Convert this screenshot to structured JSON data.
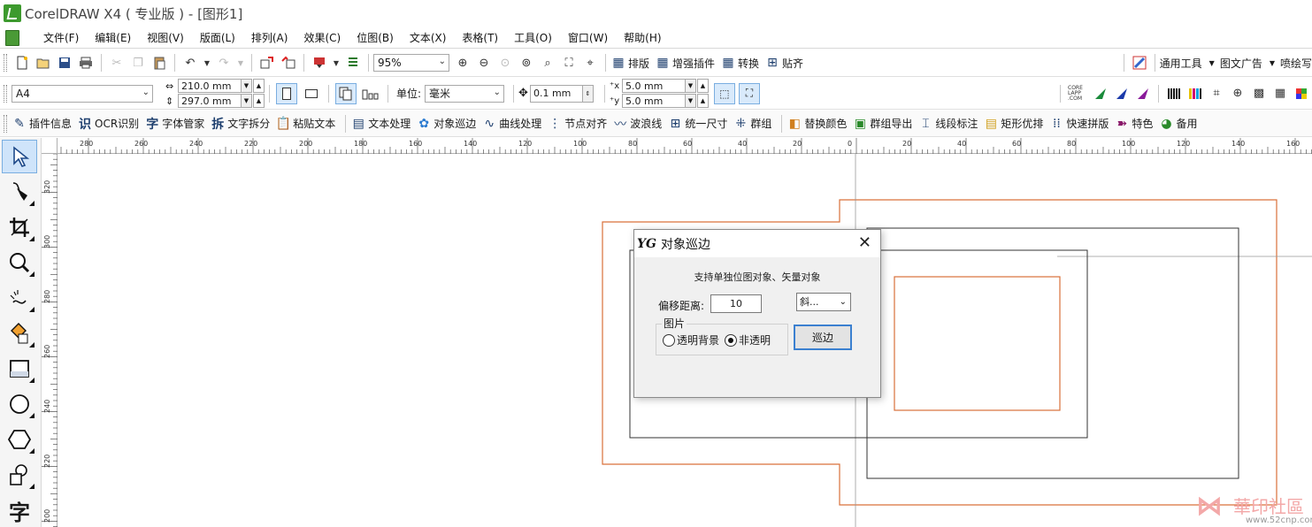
{
  "window": {
    "title": "CorelDRAW X4 ( 专业版 ) - [图形1]"
  },
  "menu": [
    "文件(F)",
    "编辑(E)",
    "视图(V)",
    "版面(L)",
    "排列(A)",
    "效果(C)",
    "位图(B)",
    "文本(X)",
    "表格(T)",
    "工具(O)",
    "窗口(W)",
    "帮助(H)"
  ],
  "standard_toolbar": {
    "zoom_value": "95%",
    "plugin_buttons": [
      "排版",
      "增强插件",
      "转换",
      "贴齐"
    ],
    "right_buttons": [
      "通用工具",
      "图文广告",
      "喷绘写"
    ]
  },
  "property_bar": {
    "paper_size": "A4",
    "width": "210.0 mm",
    "height": "297.0 mm",
    "unit_label": "单位:",
    "unit_value": "毫米",
    "nudge": "0.1 mm",
    "dup_x": "5.0 mm",
    "dup_y": "5.0 mm"
  },
  "plugin_toolbar": [
    "插件信息",
    "OCR识别",
    "字体管家",
    "文字拆分",
    "粘贴文本",
    "文本处理",
    "对象巡边",
    "曲线处理",
    "节点对齐",
    "波浪线",
    "统一尺寸",
    "群组",
    "替换颜色",
    "群组导出",
    "线段标注",
    "矩形优排",
    "快速拼版",
    "特色",
    "备用"
  ],
  "rulers": {
    "horizontal_labels": [
      "280",
      "260",
      "240",
      "220",
      "200",
      "180",
      "160",
      "140",
      "120",
      "100",
      "80",
      "60",
      "40",
      "20",
      "0",
      "20",
      "40",
      "60",
      "80",
      "100",
      "120",
      "140",
      "160"
    ],
    "vertical_labels": [
      "320",
      "300",
      "280",
      "260",
      "240",
      "220",
      "200"
    ]
  },
  "dialog": {
    "title": "对象巡边",
    "info": "支持单独位图对象、矢量对象",
    "offset_label": "偏移距离:",
    "offset_value": "10",
    "corner_select": "斜...",
    "group_label": "图片",
    "radio_transparent": "透明背景",
    "radio_opaque": "非透明",
    "selected_radio": "非透明",
    "run_button": "巡边"
  },
  "watermark": {
    "site": "華印社區",
    "url": "www.52cnp.com"
  },
  "colors": {
    "outline_orange": "#d9703a",
    "outline_dark": "#333333",
    "accent_blue": "#3b80d0",
    "logo_green": "#3d9a2e"
  }
}
